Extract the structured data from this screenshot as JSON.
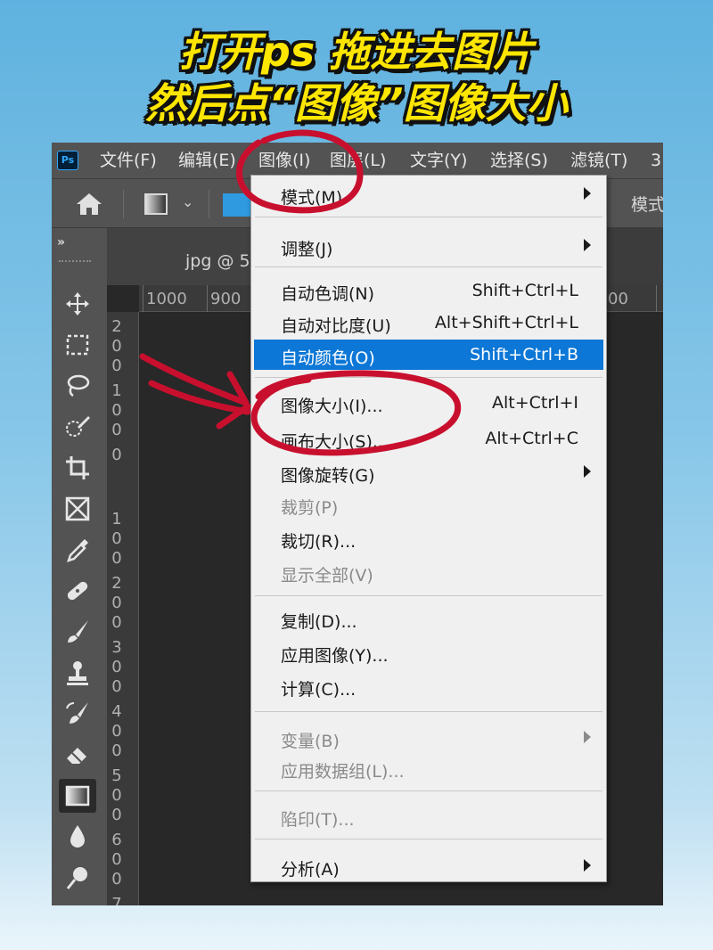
{
  "headline": {
    "line1": "打开ps 拖进去图片",
    "line2": "然后点“图像”图像大小"
  },
  "app": {
    "logo": "Ps",
    "menubar": [
      "文件(F)",
      "编辑(E)",
      "图像(I)",
      "图层(L)",
      "文字(Y)",
      "选择(S)",
      "滤镜(T)",
      "3"
    ]
  },
  "options_bar": {
    "mode_label": "模式"
  },
  "document": {
    "tab_title": "jpg @ 5",
    "hruler_labels": [
      "1000",
      "900",
      "00"
    ],
    "vruler_labels": [
      "200",
      "100",
      "0",
      "100",
      "200",
      "300",
      "400",
      "500",
      "600",
      "7"
    ]
  },
  "tools": [
    "move-icon",
    "marquee-icon",
    "lasso-icon",
    "quick-select-icon",
    "crop-icon",
    "frame-icon",
    "eyedropper-icon",
    "healing-icon",
    "brush-icon",
    "stamp-icon",
    "history-brush-icon",
    "eraser-icon",
    "gradient-icon",
    "blur-icon",
    "dodge-icon"
  ],
  "image_menu": {
    "items": [
      {
        "label": "模式(M)",
        "shortcut": "",
        "submenu": true,
        "disabled": false
      },
      {
        "label": "调整(J)",
        "shortcut": "",
        "submenu": true,
        "disabled": false
      },
      {
        "label": "自动色调(N)",
        "shortcut": "Shift+Ctrl+L",
        "submenu": false,
        "disabled": false
      },
      {
        "label": "自动对比度(U)",
        "shortcut": "Alt+Shift+Ctrl+L",
        "submenu": false,
        "disabled": false
      },
      {
        "label": "自动颜色(O)",
        "shortcut": "Shift+Ctrl+B",
        "submenu": false,
        "disabled": false,
        "highlighted": true
      },
      {
        "label": "图像大小(I)...",
        "shortcut": "Alt+Ctrl+I",
        "submenu": false,
        "disabled": false
      },
      {
        "label": "画布大小(S)...",
        "shortcut": "Alt+Ctrl+C",
        "submenu": false,
        "disabled": false
      },
      {
        "label": "图像旋转(G)",
        "shortcut": "",
        "submenu": true,
        "disabled": false
      },
      {
        "label": "裁剪(P)",
        "shortcut": "",
        "submenu": false,
        "disabled": true
      },
      {
        "label": "裁切(R)...",
        "shortcut": "",
        "submenu": false,
        "disabled": false
      },
      {
        "label": "显示全部(V)",
        "shortcut": "",
        "submenu": false,
        "disabled": true
      },
      {
        "label": "复制(D)...",
        "shortcut": "",
        "submenu": false,
        "disabled": false
      },
      {
        "label": "应用图像(Y)...",
        "shortcut": "",
        "submenu": false,
        "disabled": false
      },
      {
        "label": "计算(C)...",
        "shortcut": "",
        "submenu": false,
        "disabled": false
      },
      {
        "label": "变量(B)",
        "shortcut": "",
        "submenu": true,
        "disabled": true
      },
      {
        "label": "应用数据组(L)...",
        "shortcut": "",
        "submenu": false,
        "disabled": true
      },
      {
        "label": "陷印(T)...",
        "shortcut": "",
        "submenu": false,
        "disabled": true
      },
      {
        "label": "分析(A)",
        "shortcut": "",
        "submenu": true,
        "disabled": false
      }
    ]
  },
  "colors": {
    "highlight": "#0c77d6",
    "annotation_red": "#c8102e",
    "headline_yellow": "#ffe600"
  }
}
